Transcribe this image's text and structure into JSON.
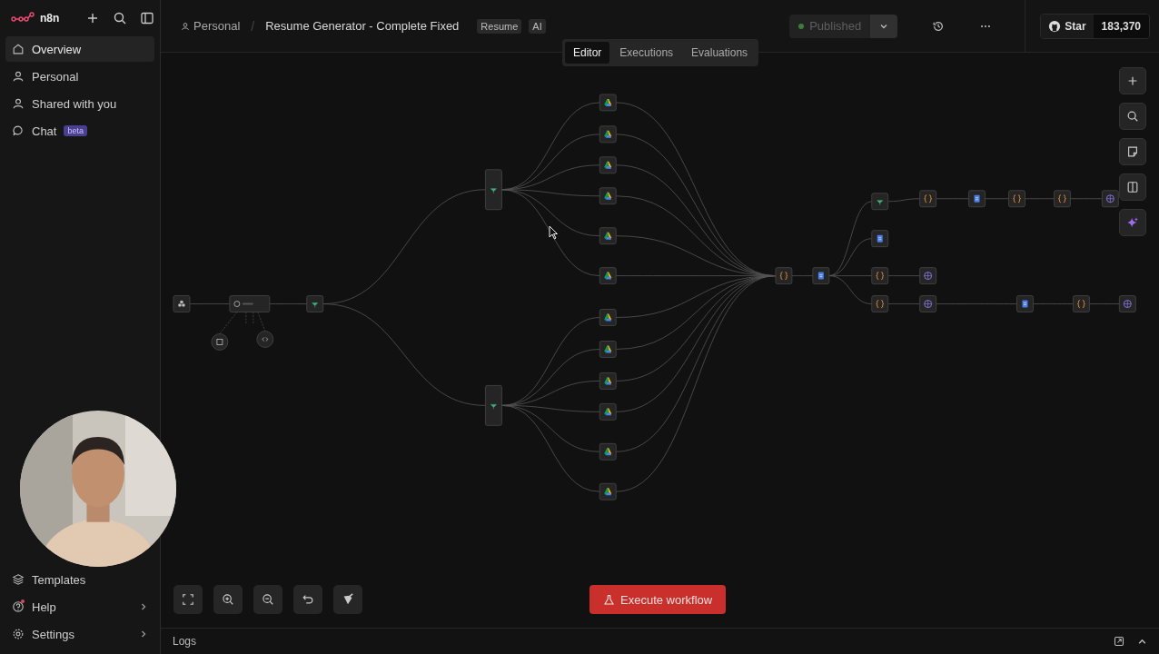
{
  "sidebar": {
    "brand": "n8n",
    "items": [
      {
        "label": "Overview",
        "selected": true
      },
      {
        "label": "Personal",
        "selected": false
      },
      {
        "label": "Shared with you",
        "selected": false
      },
      {
        "label": "Chat",
        "selected": false,
        "badge": "beta"
      }
    ],
    "bottom_items": [
      {
        "label": "Templates",
        "submenu": false,
        "notification": false
      },
      {
        "label": "Help",
        "submenu": true,
        "notification": true
      },
      {
        "label": "Settings",
        "submenu": true,
        "notification": false
      }
    ]
  },
  "header": {
    "breadcrumb": "Personal",
    "separator": "/",
    "title": "Resume Generator - Complete Fixed",
    "tags": [
      "Resume",
      "AI"
    ],
    "publish": {
      "label": "Published",
      "disabled": true
    },
    "github": {
      "label": "Star",
      "count": "183,370"
    }
  },
  "view_tabs": [
    {
      "label": "Editor",
      "selected": true
    },
    {
      "label": "Executions",
      "selected": false
    },
    {
      "label": "Evaluations",
      "selected": false
    }
  ],
  "canvas": {
    "nodes": [
      {
        "kind": "webhook"
      },
      {
        "kind": "agent"
      },
      {
        "kind": "model"
      },
      {
        "kind": "parser"
      },
      {
        "kind": "switch"
      },
      {
        "kind": "router"
      },
      {
        "kind": "router"
      },
      {
        "kind": "drive"
      },
      {
        "kind": "drive"
      },
      {
        "kind": "drive"
      },
      {
        "kind": "drive"
      },
      {
        "kind": "drive"
      },
      {
        "kind": "drive"
      },
      {
        "kind": "drive"
      },
      {
        "kind": "drive"
      },
      {
        "kind": "drive"
      },
      {
        "kind": "drive"
      },
      {
        "kind": "drive"
      },
      {
        "kind": "drive"
      },
      {
        "kind": "code"
      },
      {
        "kind": "doc"
      },
      {
        "kind": "switch"
      },
      {
        "kind": "code"
      },
      {
        "kind": "doc"
      },
      {
        "kind": "code"
      },
      {
        "kind": "code"
      },
      {
        "kind": "http"
      },
      {
        "kind": "doc"
      },
      {
        "kind": "code"
      },
      {
        "kind": "http"
      },
      {
        "kind": "code"
      },
      {
        "kind": "http"
      },
      {
        "kind": "doc"
      },
      {
        "kind": "code"
      },
      {
        "kind": "http"
      }
    ]
  },
  "execute_button": "Execute workflow",
  "logs": {
    "label": "Logs"
  }
}
